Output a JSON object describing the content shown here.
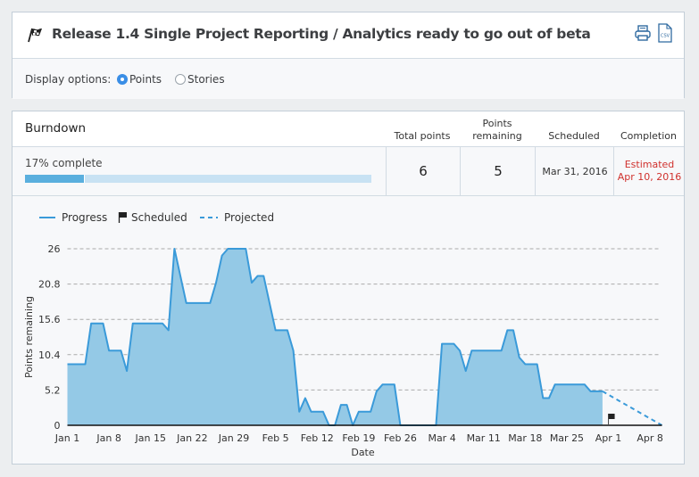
{
  "header": {
    "title": "Release 1.4 Single Project Reporting / Analytics ready to go out of beta",
    "icons": {
      "title_icon": "checkered-flag-icon",
      "print": "printer-icon",
      "csv": "csv-file-icon"
    },
    "csv_icon_text": "CSV"
  },
  "display_options": {
    "label": "Display options:",
    "options": [
      {
        "label": "Points",
        "selected": true
      },
      {
        "label": "Stories",
        "selected": false
      }
    ]
  },
  "burndown": {
    "title": "Burndown",
    "progress_label": "17% complete",
    "progress_fraction": 0.17,
    "columns": [
      {
        "header": "Total points",
        "value": "6"
      },
      {
        "header": "Points\nremaining",
        "header_line1": "Points",
        "header_line2": "remaining",
        "value": "5"
      },
      {
        "header": "Scheduled",
        "value": "Mar 31, 2016"
      },
      {
        "header": "Completion",
        "value_line1": "Estimated",
        "value_line2": "Apr 10, 2016"
      }
    ],
    "colors": {
      "progress": "#3a9ad9",
      "area": "#94c9e6",
      "estimate_red": "#d0312d",
      "bar_fill": "#5aafde",
      "bar_bg": "#c8e2f3"
    }
  },
  "chart_data": {
    "type": "area",
    "title": "",
    "xlabel": "Date",
    "ylabel": "Points remaining",
    "yticks": [
      "0",
      "5.2",
      "10.4",
      "15.6",
      "20.8",
      "26"
    ],
    "ylim": [
      0,
      26
    ],
    "xticks": [
      "Jan 1",
      "Jan 8",
      "Jan 15",
      "Jan 22",
      "Jan 29",
      "Feb 5",
      "Feb 12",
      "Feb 19",
      "Feb 26",
      "Mar 4",
      "Mar 11",
      "Mar 18",
      "Mar 25",
      "Apr 1",
      "Apr 8"
    ],
    "x_unit": "days since Jan 1, 2016",
    "xlim": [
      0,
      100
    ],
    "grid": "horizontal dashed",
    "legend": {
      "position": "top-left",
      "items": [
        {
          "name": "Progress",
          "style": "solid-line"
        },
        {
          "name": "Scheduled",
          "style": "flag"
        },
        {
          "name": "Projected",
          "style": "dashed-line"
        }
      ]
    },
    "series": [
      {
        "name": "Progress",
        "points": [
          [
            0,
            9
          ],
          [
            3,
            9
          ],
          [
            4,
            15
          ],
          [
            6,
            15
          ],
          [
            7,
            11
          ],
          [
            9,
            11
          ],
          [
            10,
            8
          ],
          [
            11,
            15
          ],
          [
            16,
            15
          ],
          [
            17,
            14
          ],
          [
            18,
            26
          ],
          [
            20,
            18
          ],
          [
            24,
            18
          ],
          [
            25,
            21
          ],
          [
            26,
            25
          ],
          [
            27,
            26
          ],
          [
            30,
            26
          ],
          [
            31,
            21
          ],
          [
            32,
            22
          ],
          [
            33,
            22
          ],
          [
            35,
            14
          ],
          [
            37,
            14
          ],
          [
            38,
            11
          ],
          [
            39,
            2
          ],
          [
            40,
            4
          ],
          [
            41,
            2
          ],
          [
            43,
            2
          ],
          [
            44,
            0
          ],
          [
            45,
            0
          ],
          [
            46,
            3
          ],
          [
            47,
            3
          ],
          [
            48,
            0
          ],
          [
            49,
            2
          ],
          [
            51,
            2
          ],
          [
            52,
            5
          ],
          [
            53,
            6
          ],
          [
            55,
            6
          ],
          [
            56,
            0
          ],
          [
            62,
            0
          ],
          [
            63,
            12
          ],
          [
            65,
            12
          ],
          [
            66,
            11
          ],
          [
            67,
            8
          ],
          [
            68,
            11
          ],
          [
            73,
            11
          ],
          [
            74,
            14
          ],
          [
            75,
            14
          ],
          [
            76,
            10
          ],
          [
            77,
            9
          ],
          [
            79,
            9
          ],
          [
            80,
            4
          ],
          [
            81,
            4
          ],
          [
            82,
            6
          ],
          [
            87,
            6
          ],
          [
            88,
            5
          ],
          [
            90,
            5
          ]
        ]
      },
      {
        "name": "Projected",
        "points": [
          [
            90,
            5
          ],
          [
            100,
            0
          ]
        ]
      },
      {
        "name": "Scheduled",
        "points": [
          [
            91,
            0
          ]
        ]
      }
    ]
  }
}
